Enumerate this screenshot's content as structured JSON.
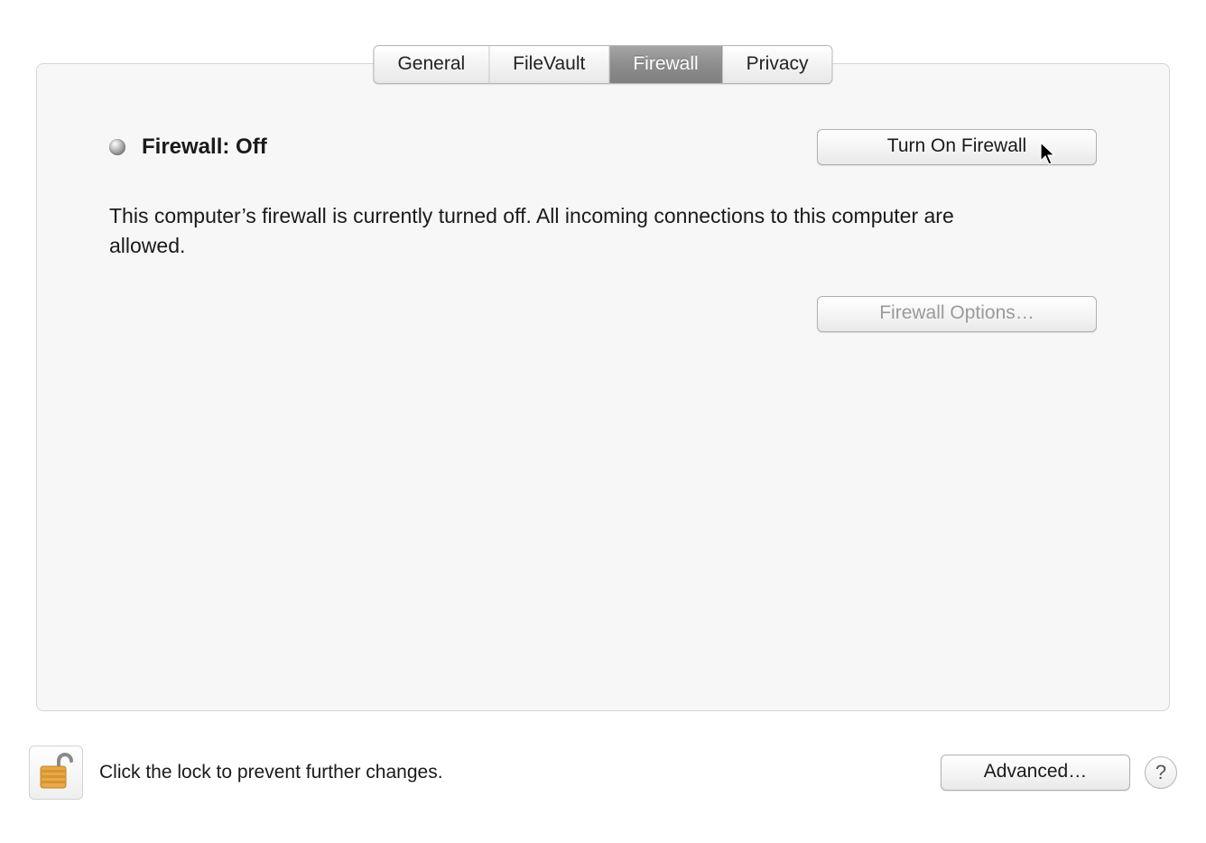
{
  "tabs": {
    "items": [
      {
        "label": "General"
      },
      {
        "label": "FileVault"
      },
      {
        "label": "Firewall"
      },
      {
        "label": "Privacy"
      }
    ],
    "active_index": 2
  },
  "main": {
    "status_label": "Firewall: Off",
    "turn_on_label": "Turn On Firewall",
    "description": "This computer’s firewall is currently turned off. All incoming connections to this computer are allowed.",
    "options_label": "Firewall Options…"
  },
  "footer": {
    "lock_text": "Click the lock to prevent further changes.",
    "advanced_label": "Advanced…",
    "help_label": "?"
  }
}
